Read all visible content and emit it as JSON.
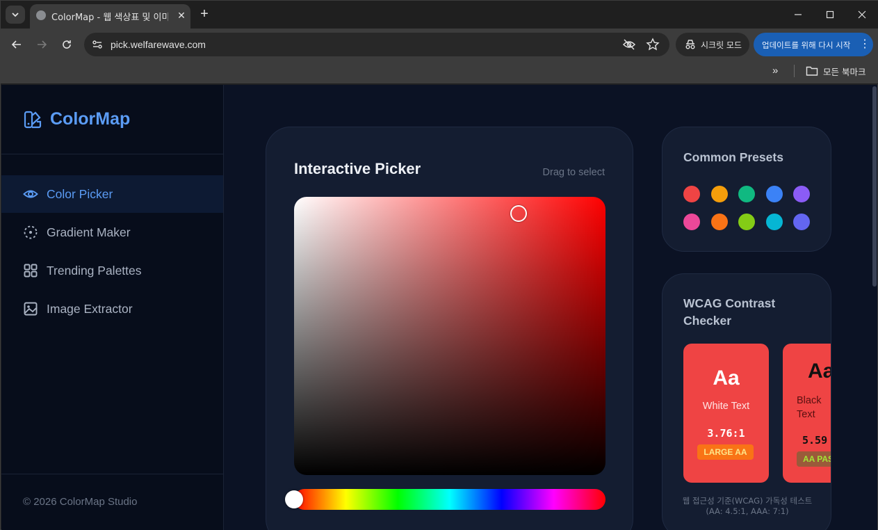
{
  "browser": {
    "tab_title": "ColorMap - 웹 색상표 및 이미지",
    "url": "pick.welfarewave.com",
    "incognito_label": "시크릿 모드",
    "update_label": "업데이트를 위해 다시 시작",
    "bookmarks_label": "모든 북마크",
    "bookmarks_more": "»"
  },
  "sidebar": {
    "brand": "ColorMap",
    "items": [
      {
        "label": "Color Picker",
        "icon": "eye-icon",
        "active": true
      },
      {
        "label": "Gradient Maker",
        "icon": "gradient-icon",
        "active": false
      },
      {
        "label": "Trending Palettes",
        "icon": "grid-icon",
        "active": false
      },
      {
        "label": "Image Extractor",
        "icon": "image-icon",
        "active": false
      }
    ],
    "footer": "© 2026 ColorMap Studio"
  },
  "picker": {
    "title": "Interactive Picker",
    "hint": "Drag to select",
    "hue": 0,
    "saturation": 0.72,
    "value": 0.94
  },
  "presets": {
    "title": "Common Presets",
    "colors": [
      "#ef4444",
      "#f59e0b",
      "#10b981",
      "#3b82f6",
      "#8b5cf6",
      "#ec4899",
      "#f97316",
      "#84cc16",
      "#06b6d4",
      "#6366f1"
    ]
  },
  "wcag": {
    "title": "WCAG Contrast Checker",
    "samples": [
      {
        "aa": "Aa",
        "desc": "White Text",
        "ratio": "3.76:1",
        "badge": "LARGE AA"
      },
      {
        "aa": "Aa",
        "desc": "Black Text",
        "ratio": "5.59",
        "badge": "AA PASS"
      }
    ],
    "note": "웹 접근성 기준(WCAG) 가독성 테스트 (AA: 4.5:1, AAA: 7:1)"
  }
}
